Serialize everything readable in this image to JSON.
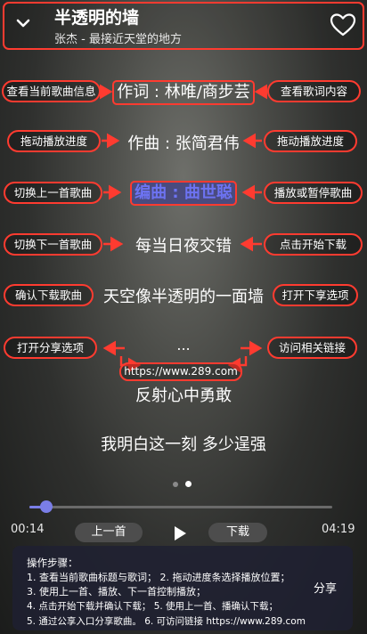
{
  "header": {
    "title": "半透明的墙",
    "subtitle": "张杰 - 最接近天堂的地方"
  },
  "callouts": {
    "song_info": "查看当前歌曲信息",
    "lyrics_content": "查看歌词内容",
    "drag_progress_left": "拖动播放进度",
    "drag_progress_right": "拖动播放进度",
    "prev_song": "切换上一首歌曲",
    "play_pause": "播放或暂停歌曲",
    "next_song": "切换下一首歌曲",
    "start_download": "点击开始下载",
    "confirm_download": "确认下载歌曲",
    "open_share_right": "打开下享选项",
    "open_share_left": "打开分享选项",
    "visit_link": "访问相关链接"
  },
  "lyrics": [
    "作词 : 林唯/商步芸",
    "作曲 : 张简君伟",
    "编曲 : 曲世聪",
    "每当日夜交错",
    "天空像半透明的一面墙",
    "...",
    "反射心中勇敢",
    "我明白这一刻 多少逞强"
  ],
  "url_badge": "https://www.289.com",
  "player": {
    "current_time": "00:14",
    "total_time": "04:19",
    "progress": 0.055,
    "prev_label": "上一首",
    "next_label": "下载"
  },
  "instructions": {
    "title": "操作步骤：",
    "lines": [
      "1. 查看当前歌曲标题与歌词；  2. 拖动进度条选择播放位置；",
      "3. 使用上一首、播放、下一首控制播放；",
      "4. 点击开始下载并确认下载；  5. 使用上一首、播确认下载；",
      "5. 通过公享入口分享歌曲。      6. 可访问链接 https://www.289.com"
    ],
    "share_label": "分享"
  },
  "colors": {
    "annotation": "#ff3b30",
    "accent": "#7a7ee8",
    "active_lyric": "#6d73f2"
  },
  "icons": [
    "chevron-down-icon",
    "heart-icon",
    "play-icon",
    "arrow-left-icon",
    "arrow-right-icon"
  ]
}
